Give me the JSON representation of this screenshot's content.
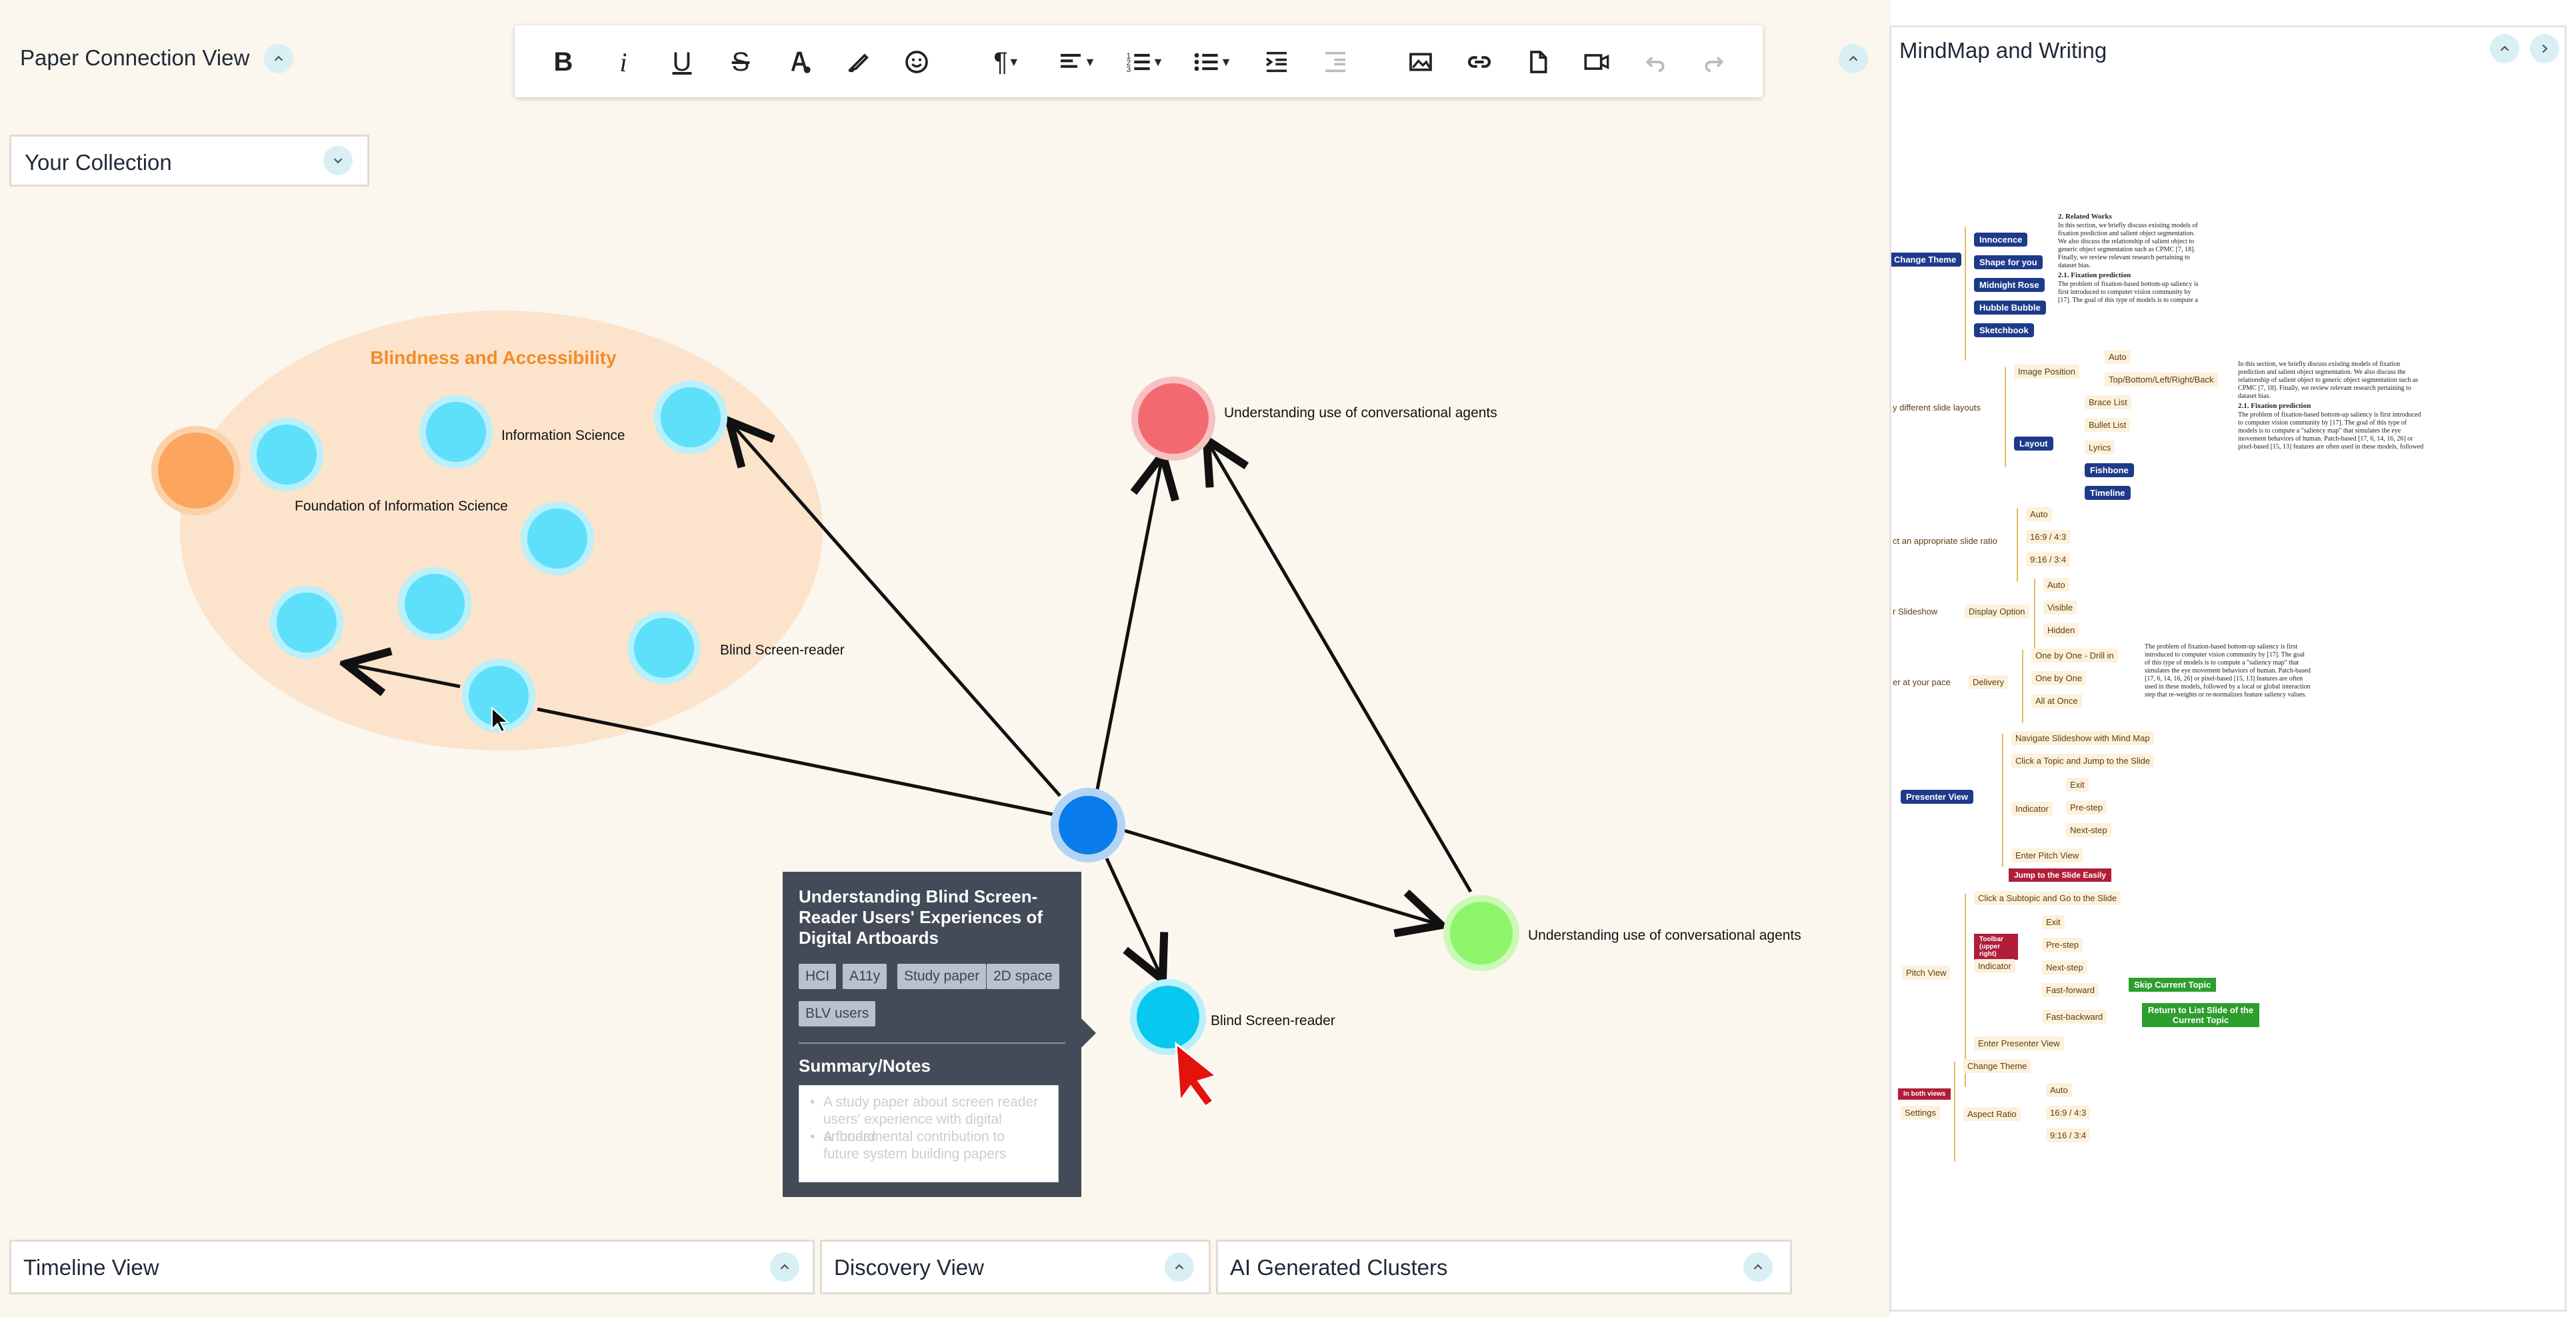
{
  "canvas": {
    "title": "Paper Connection View",
    "collection_label": "Your Collection"
  },
  "toolbar": {
    "buttons": [
      {
        "name": "bold",
        "label": "B"
      },
      {
        "name": "italic",
        "label": "i"
      },
      {
        "name": "underline",
        "label": "U"
      },
      {
        "name": "strikethrough",
        "label": "S"
      },
      {
        "name": "text-color",
        "label": ""
      },
      {
        "name": "highlight",
        "label": ""
      },
      {
        "name": "emoji",
        "label": ""
      },
      {
        "name": "paragraph",
        "label": "¶"
      },
      {
        "name": "align",
        "label": ""
      },
      {
        "name": "ordered-list",
        "label": ""
      },
      {
        "name": "bullet-list",
        "label": ""
      },
      {
        "name": "indent",
        "label": ""
      },
      {
        "name": "outdent",
        "label": ""
      },
      {
        "name": "image",
        "label": ""
      },
      {
        "name": "link",
        "label": ""
      },
      {
        "name": "file",
        "label": ""
      },
      {
        "name": "video",
        "label": ""
      },
      {
        "name": "undo",
        "label": ""
      },
      {
        "name": "redo",
        "label": ""
      }
    ]
  },
  "graph": {
    "cluster_title": "Blindness and Accessibility",
    "labels": {
      "information_science": "Information Science",
      "foundation": "Foundation of Information Science",
      "blind_screen_reader_cluster": "Blind Screen-reader",
      "conv_agents_red": "Understanding use of conversational agents",
      "conv_agents_green": "Understanding use of conversational agents",
      "blind_screen_reader_target": "Blind Screen-reader"
    },
    "colors": {
      "cluster_fill": "#fbe3cc",
      "cluster_title": "#f28c28",
      "node_cyan": "#5ee0fb",
      "node_blue": "#0a7bea",
      "node_red": "#f26a6f",
      "node_green": "#8ef56b",
      "node_orange": "#fba55e"
    }
  },
  "card": {
    "title": "Understanding Blind Screen-Reader Users' Experiences of Digital Artboards",
    "tags": [
      "HCI",
      "A11y",
      "Study paper",
      "2D space",
      "BLV users"
    ],
    "summary_title": "Summary/Notes",
    "notes": [
      "A study paper about screen reader users' experience with digital artboard",
      "A fundamental contribution to future system building papers"
    ]
  },
  "bottom_bars": [
    {
      "name": "timeline-view",
      "label": "Timeline View"
    },
    {
      "name": "discovery-view",
      "label": "Discovery View"
    },
    {
      "name": "ai-generated-clusters",
      "label": "AI Generated Clusters"
    }
  ],
  "right_panel": {
    "title": "MindMap and Writing",
    "mindmap": {
      "change_theme": "Change Theme",
      "themes": [
        "Innocence",
        "Shape for you",
        "Midnight Rose",
        "Hubble Bubble",
        "Sketchbook"
      ],
      "slide_layouts": "y different slide layouts",
      "image_position": "Image Position",
      "image_position_opts": [
        "Auto",
        "Top/Bottom/Left/Right/Back"
      ],
      "layout": "Layout",
      "layout_opts": [
        "Brace List",
        "Bullet List",
        "Lyrics",
        "Fishbone",
        "Timeline"
      ],
      "slide_ratio": "ct an appropriate slide ratio",
      "ratio_opts": [
        "Auto",
        "16:9 / 4:3",
        "9:16 / 3:4"
      ],
      "slideshow": "r Slideshow",
      "display_option": "Display Option",
      "display_opts": [
        "Auto",
        "Visible",
        "Hidden"
      ],
      "pace": "er at your pace",
      "delivery": "Delivery",
      "delivery_opts": [
        "One by One - Drill in",
        "One by One",
        "All at Once"
      ],
      "presenter_view": "Presenter View",
      "presenter_items": [
        "Navigate Slideshow with Mind Map",
        "Click a Topic and Jump to the Slide",
        "Indicator",
        "Enter Pitch View"
      ],
      "indicator_opts": [
        "Exit",
        "Pre-step",
        "Next-step"
      ],
      "jump_badge": "Jump to the Slide Easily",
      "pitch_view": "Pitch View",
      "pitch_items": [
        "Click a Subtopic and Go to the Slide",
        "Indicator",
        "Enter Presenter View"
      ],
      "toolbar_badge": "Toolbar (upper right)",
      "pitch_indicator_opts": [
        "Exit",
        "Pre-step",
        "Next-step",
        "Fast-forward",
        "Fast-backward"
      ],
      "skip_current": "Skip Current Topic",
      "return_list": "Return to List Slide of the Current Topic",
      "both_views": "In both views",
      "settings": "Settings",
      "settings_items": [
        "Change Theme",
        "Aspect Ratio"
      ],
      "aspect_opts": [
        "Auto",
        "16:9 / 4:3",
        "9:16 / 3:4"
      ]
    },
    "doc": {
      "heading1": "2. Related Works",
      "para1": "In this section, we briefly discuss existing models of fixation prediction and salient object segmentation. We also discuss the relationship of salient object to generic object segmentation such as CPMC [7, 18]. Finally, we review relevant research pertaining to dataset bias.",
      "heading2": "2.1. Fixation prediction",
      "para2": "The problem of fixation-based bottom-up saliency is first introduced to computer vision community by [17]. The goal of this type of models is to compute a \"saliency map\" that simulates the eye movement behaviors of human. Patch-based [17, 6, 14, 16, 26] or pixel-based [15, 13] features are often used in these models, followed by a local or global interaction step that re-weights or re-normalizes feature saliency values."
    }
  }
}
